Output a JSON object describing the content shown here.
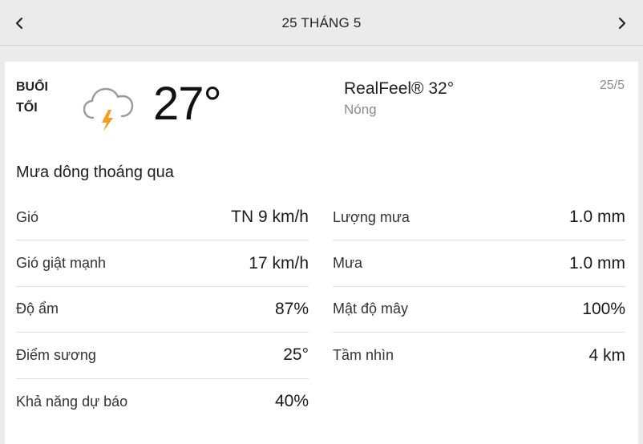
{
  "header": {
    "date_title": "25 THÁNG 5",
    "prev_icon": "chevron-left-icon",
    "next_icon": "chevron-right-icon"
  },
  "card": {
    "period_line1": "BUỔI",
    "period_line2": "TỐI",
    "weather_icon": "thunderstorm-cloud-icon",
    "temperature": "27°",
    "realfeel": "RealFeel® 32°",
    "realfeel_phrase": "Nóng",
    "date_short": "25/5",
    "phrase": "Mưa dông thoáng qua",
    "details_left": [
      {
        "label": "Gió",
        "value": "TN 9 km/h"
      },
      {
        "label": "Gió giật mạnh",
        "value": "17 km/h"
      },
      {
        "label": "Độ ẩm",
        "value": "87%"
      },
      {
        "label": "Điểm sương",
        "value": "25°"
      },
      {
        "label": "Khả năng dự báo",
        "value": "40%"
      }
    ],
    "details_right": [
      {
        "label": "Lượng mưa",
        "value": "1.0 mm"
      },
      {
        "label": "Mưa",
        "value": "1.0 mm"
      },
      {
        "label": "Mật độ mây",
        "value": "100%"
      },
      {
        "label": "Tầm nhìn",
        "value": "4 km"
      }
    ]
  },
  "colors": {
    "background": "#ebebeb",
    "card": "#ffffff",
    "muted_text": "#8a8a8a",
    "bolt": "#f0a020"
  }
}
